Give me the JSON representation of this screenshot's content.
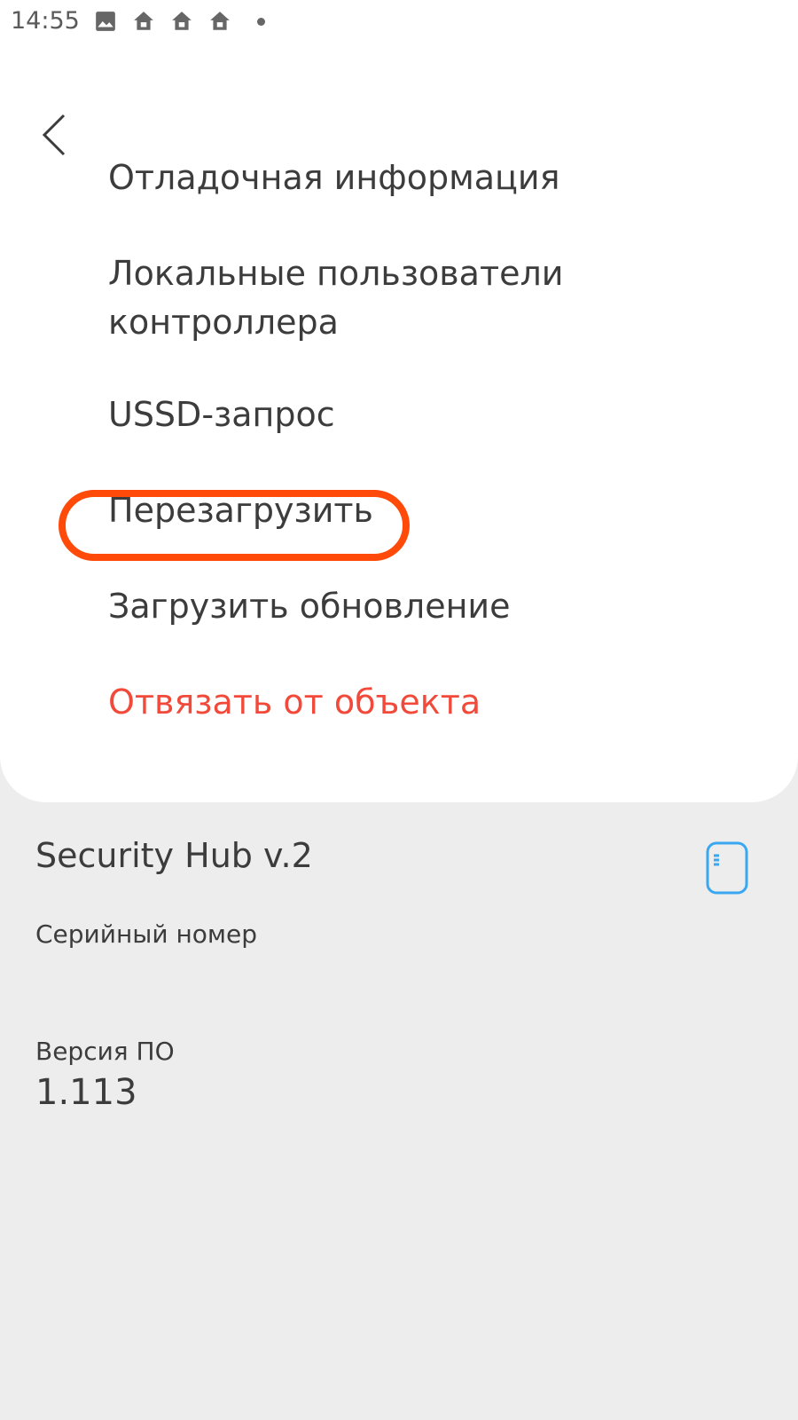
{
  "status_bar": {
    "time": "14:55",
    "icons": [
      "image-icon",
      "home-icon",
      "home-icon",
      "home-icon",
      "dot-icon"
    ]
  },
  "menu": {
    "items": [
      {
        "label": "Отладочная информация"
      },
      {
        "label": "Локальные пользователи\nконтроллера"
      },
      {
        "label": "USSD-запрос"
      },
      {
        "label": "Перезагрузить",
        "highlighted": true
      },
      {
        "label": "Загрузить обновление"
      },
      {
        "label": "Отвязать от объекта",
        "color": "#f24a3a"
      }
    ],
    "highlight_color": "#ff4a0a"
  },
  "device": {
    "title": "Security Hub v.2",
    "icon": "hub-device-icon",
    "icon_color": "#3aa8f0",
    "serial_label": "Серийный номер",
    "firmware_label": "Версия ПО",
    "firmware_value": "1.113"
  }
}
